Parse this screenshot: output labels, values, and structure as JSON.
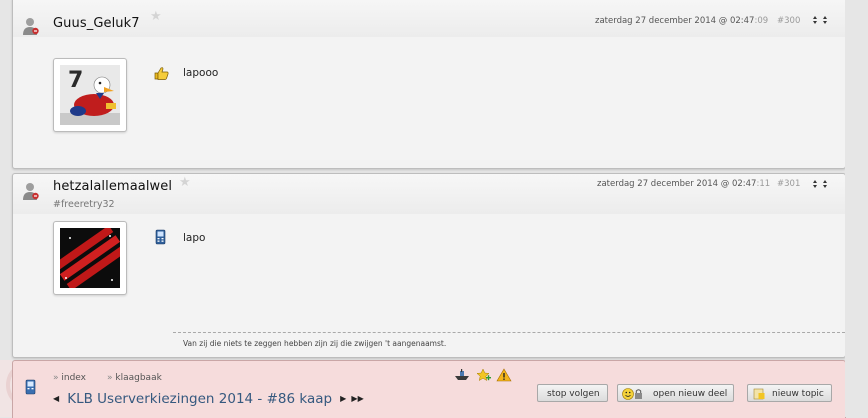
{
  "posts": [
    {
      "username": "Guus_Geluk7",
      "usertag": "",
      "date": "zaterdag 27 december 2014 @ 02:47",
      "seconds": ":09",
      "number": "#300",
      "text": "lapooo",
      "device_icon": "thumbs-up-icon"
    },
    {
      "username": "hetzalallemaalwel",
      "usertag": "#freeretry32",
      "date": "zaterdag 27 december 2014 @ 02:47",
      "seconds": ":11",
      "number": "#301",
      "text": "lapo",
      "device_icon": "mobile-phone-icon",
      "signature": "Van zij die niets te zeggen hebben zijn zij die zwijgen 't aangenaamst."
    }
  ],
  "bottombar": {
    "raquo": "»",
    "index_label": "index",
    "klaagbaak_label": "klaagbaak",
    "thread_title": "KLB Userverkiezingen 2014 - #86 kaap",
    "stop_volgen_label": "stop volgen",
    "nieuw_deel_label": "open nieuw deel",
    "nieuw_topic_label": "nieuw topic"
  },
  "colors": {
    "bottombar_bg": "#f6dcdc",
    "title_link": "#35597f",
    "post_bg": "#f3f3f3"
  }
}
